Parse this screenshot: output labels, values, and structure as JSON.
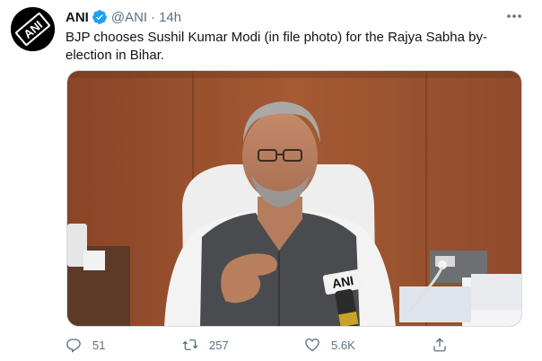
{
  "tweet": {
    "author_name": "ANI",
    "handle": "@ANI",
    "separator": "·",
    "time": "14h",
    "text": "BJP chooses Sushil Kumar Modi (in file photo) for the Rajya Sabha by-election in Bihar.",
    "avatar_logo_text": "ANI",
    "media_mic_text": "ANI"
  },
  "stats": {
    "replies": "51",
    "retweets": "257",
    "likes": "5.6K"
  },
  "icons": {
    "verified": "verified-badge-icon",
    "more": "more-dots-icon",
    "reply": "reply-icon",
    "retweet": "retweet-icon",
    "like": "heart-icon",
    "share": "share-icon"
  },
  "colors": {
    "text": "#0f1419",
    "secondary": "#5b7083",
    "verified": "#1da1f2",
    "wood_panel": "#9a4f2c"
  }
}
